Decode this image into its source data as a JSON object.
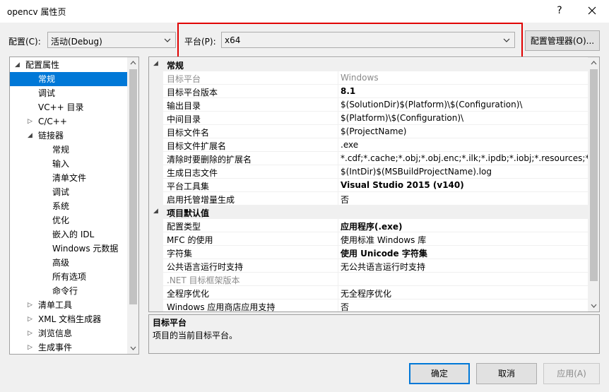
{
  "window": {
    "title": "opencv 属性页",
    "help_label": "?"
  },
  "toolbar": {
    "config_label": "配置(C):",
    "config_value": "活动(Debug)",
    "platform_label": "平台(P):",
    "platform_value": "x64",
    "config_manager_label": "配置管理器(O)..."
  },
  "tree": {
    "items": [
      {
        "label": "配置属性",
        "expander": "◢"
      },
      {
        "label": "常规",
        "expander": ""
      },
      {
        "label": "调试",
        "expander": ""
      },
      {
        "label": "VC++ 目录",
        "expander": ""
      },
      {
        "label": "C/C++",
        "expander": "▷"
      },
      {
        "label": "链接器",
        "expander": "◢"
      },
      {
        "label": "常规",
        "expander": ""
      },
      {
        "label": "输入",
        "expander": ""
      },
      {
        "label": "清单文件",
        "expander": ""
      },
      {
        "label": "调试",
        "expander": ""
      },
      {
        "label": "系统",
        "expander": ""
      },
      {
        "label": "优化",
        "expander": ""
      },
      {
        "label": "嵌入的 IDL",
        "expander": ""
      },
      {
        "label": "Windows 元数据",
        "expander": ""
      },
      {
        "label": "高级",
        "expander": ""
      },
      {
        "label": "所有选项",
        "expander": ""
      },
      {
        "label": "命令行",
        "expander": ""
      },
      {
        "label": "清单工具",
        "expander": "▷"
      },
      {
        "label": "XML 文档生成器",
        "expander": "▷"
      },
      {
        "label": "浏览信息",
        "expander": "▷"
      },
      {
        "label": "生成事件",
        "expander": "▷"
      }
    ]
  },
  "grid": {
    "category_general": "常规",
    "category_defaults": "项目默认值",
    "general_rows": [
      {
        "name": "目标平台",
        "value": "Windows"
      },
      {
        "name": "目标平台版本",
        "value": "8.1"
      },
      {
        "name": "输出目录",
        "value": "$(SolutionDir)$(Platform)\\$(Configuration)\\"
      },
      {
        "name": "中间目录",
        "value": "$(Platform)\\$(Configuration)\\"
      },
      {
        "name": "目标文件名",
        "value": "$(ProjectName)"
      },
      {
        "name": "目标文件扩展名",
        "value": ".exe"
      },
      {
        "name": "清除时要删除的扩展名",
        "value": "*.cdf;*.cache;*.obj;*.obj.enc;*.ilk;*.ipdb;*.iobj;*.resources;*.tlb;*"
      },
      {
        "name": "生成日志文件",
        "value": "$(IntDir)$(MSBuildProjectName).log"
      },
      {
        "name": "平台工具集",
        "value": "Visual Studio 2015 (v140)"
      },
      {
        "name": "启用托管增量生成",
        "value": "否"
      }
    ],
    "default_rows": [
      {
        "name": "配置类型",
        "value": "应用程序(.exe)"
      },
      {
        "name": "MFC 的使用",
        "value": "使用标准 Windows 库"
      },
      {
        "name": "字符集",
        "value": "使用 Unicode 字符集"
      },
      {
        "name": "公共语言运行时支持",
        "value": "无公共语言运行时支持"
      },
      {
        "name": ".NET 目标框架版本",
        "value": ""
      },
      {
        "name": "全程序优化",
        "value": "无全程序优化"
      },
      {
        "name": "Windows 应用商店应用支持",
        "value": "否"
      }
    ]
  },
  "description": {
    "title": "目标平台",
    "text": "项目的当前目标平台。"
  },
  "buttons": {
    "ok": "确定",
    "cancel": "取消",
    "apply": "应用(A)"
  },
  "colors": {
    "selection": "#0078d7",
    "highlight_border": "#e00000",
    "ok_border": "#0078d7"
  }
}
